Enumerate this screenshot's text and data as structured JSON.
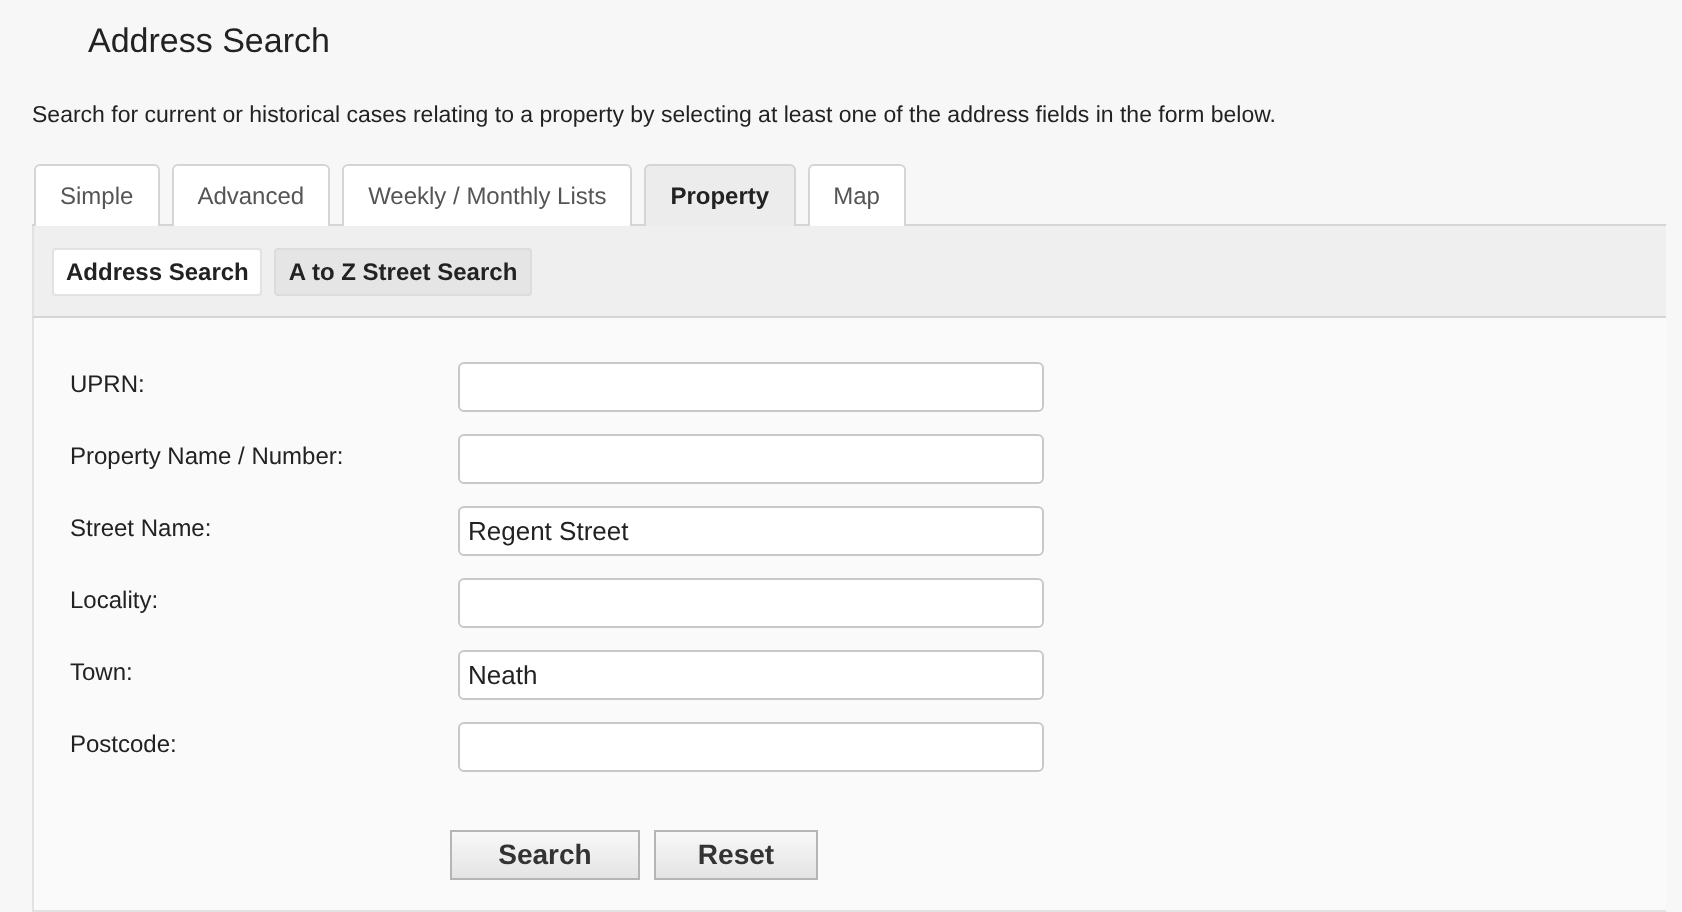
{
  "title": "Address Search",
  "description": "Search for current or historical cases relating to a property by selecting at least one of the address fields in the form below.",
  "tabs": [
    {
      "label": "Simple",
      "selected": false
    },
    {
      "label": "Advanced",
      "selected": false
    },
    {
      "label": "Weekly / Monthly Lists",
      "selected": false
    },
    {
      "label": "Property",
      "selected": true
    },
    {
      "label": "Map",
      "selected": false
    }
  ],
  "subtabs": [
    {
      "label": "Address Search",
      "selected": true
    },
    {
      "label": "A to Z Street Search",
      "selected": false
    }
  ],
  "fields": [
    {
      "label": "UPRN:"
    },
    {
      "label": "Property Name / Number:"
    },
    {
      "label": "Street Name:",
      "value": "Regent Street"
    },
    {
      "label": "Locality:"
    },
    {
      "label": "Town:",
      "value": "Neath"
    },
    {
      "label": "Postcode:"
    }
  ],
  "buttons": [
    "Search",
    "Reset"
  ]
}
